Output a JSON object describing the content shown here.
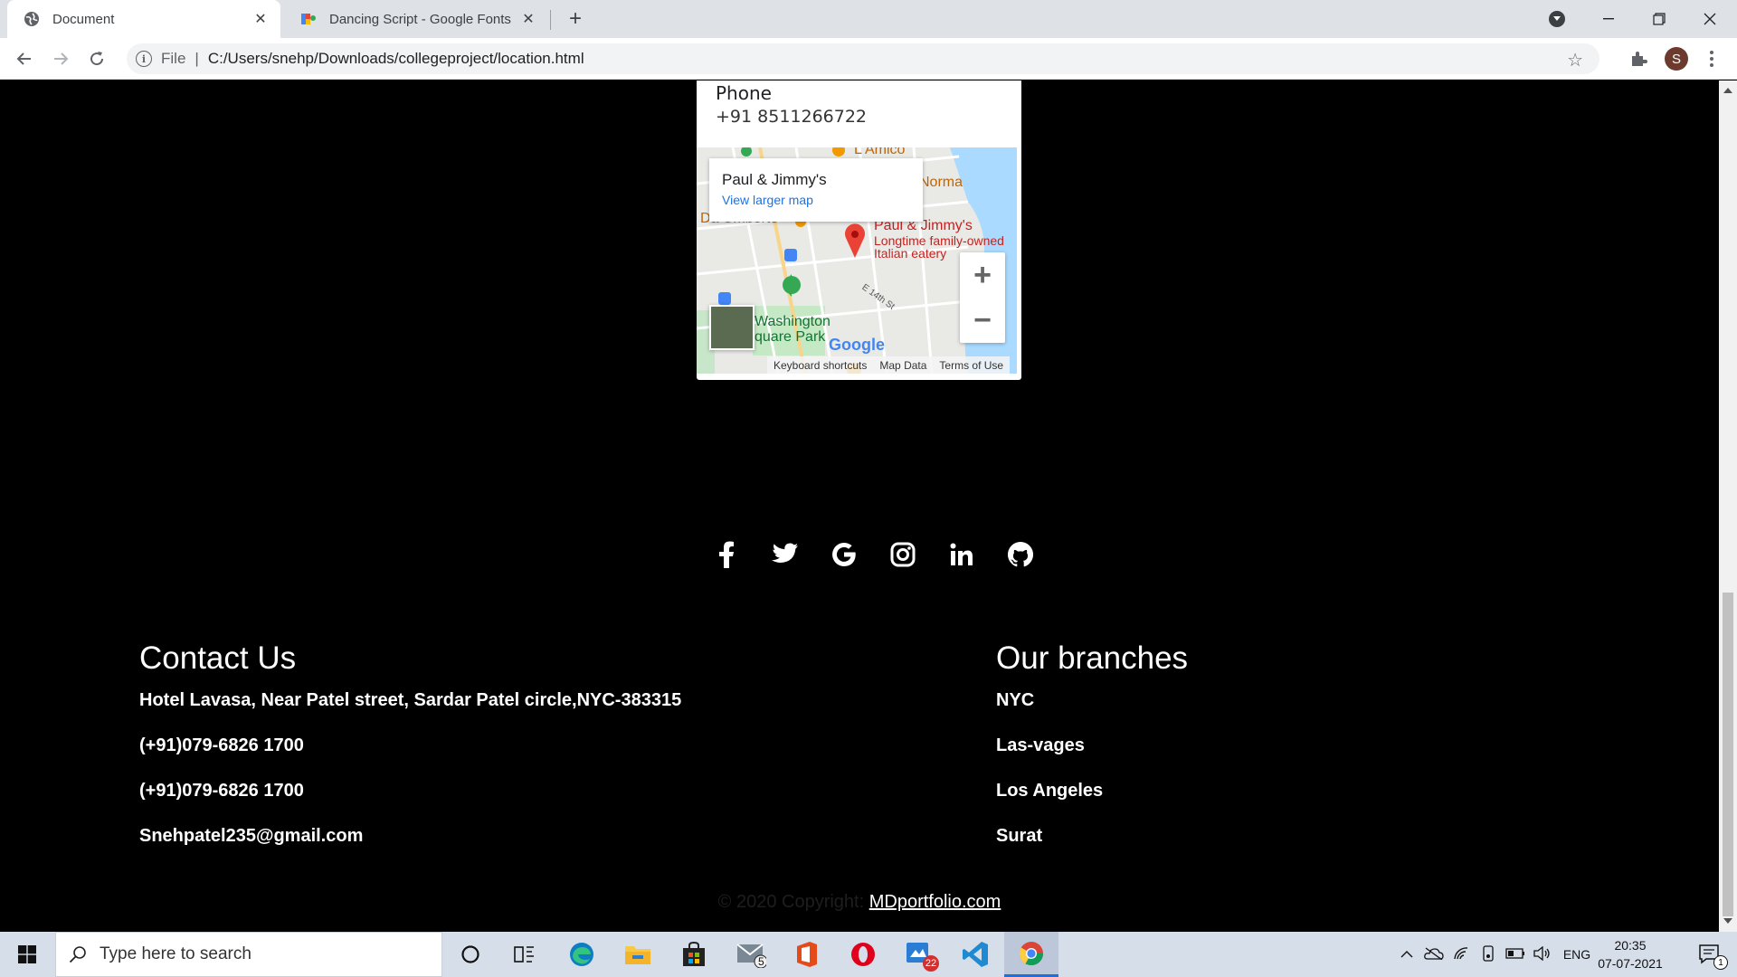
{
  "browser": {
    "tabs": [
      {
        "title": "Document",
        "active": true
      },
      {
        "title": "Dancing Script - Google Fonts",
        "active": false
      }
    ],
    "address": {
      "scheme": "File",
      "url": "C:/Users/snehp/Downloads/collegeproject/location.html"
    },
    "profile_initial": "S"
  },
  "contact_card": {
    "label": "Phone",
    "phone": "+91 8511266722"
  },
  "map": {
    "place_name": "Paul & Jimmy's",
    "view_larger": "View larger map",
    "pin_title": "Paul & Jimmy's",
    "pin_desc_1": "Longtime family-owned",
    "pin_desc_2": "Italian eatery",
    "labels": {
      "amico": "L'Amico",
      "norma": "Norma",
      "umberto": "Da Umberto",
      "park_1": "Washington",
      "park_2": "quare Park",
      "street": "E 14th St"
    },
    "logo": "Google",
    "attribution": [
      "Keyboard shortcuts",
      "Map Data",
      "Terms of Use"
    ],
    "zoom_in": "+",
    "zoom_out": "−"
  },
  "social_icons": [
    "facebook-icon",
    "twitter-icon",
    "google-icon",
    "instagram-icon",
    "linkedin-icon",
    "github-icon"
  ],
  "contact": {
    "title": "Contact Us",
    "items": [
      "Hotel Lavasa, Near Patel street, Sardar Patel circle,NYC-383315",
      "(+91)079-6826 1700",
      "(+91)079-6826 1700",
      "Snehpatel235@gmail.com"
    ]
  },
  "branches": {
    "title": "Our branches",
    "items": [
      "NYC",
      "Las-vages",
      "Los Angeles",
      "Surat"
    ]
  },
  "footer": {
    "copyright": "© 2020 Copyright: ",
    "link": "MDportfolio.com"
  },
  "taskbar": {
    "search_placeholder": "Type here to search",
    "mail_badge": "5",
    "store_badge": "22",
    "language": "ENG",
    "time": "20:35",
    "date": "07-07-2021",
    "notification_badge": "1"
  },
  "colors": {
    "accent": "#1a73e8",
    "pin": "#ea4335",
    "page_bg": "#000000"
  }
}
